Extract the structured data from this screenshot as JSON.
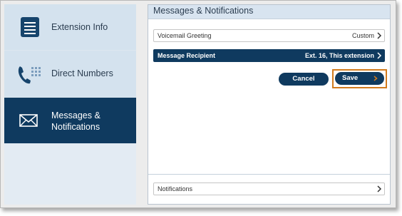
{
  "sidebar": {
    "items": [
      {
        "label": "Extension Info",
        "icon": "document-list-icon"
      },
      {
        "label": "Direct Numbers",
        "icon": "phone-keypad-icon"
      },
      {
        "label": "Messages &\nNotifications",
        "icon": "envelope-icon",
        "active": true
      }
    ]
  },
  "main": {
    "title": "Messages & Notifications",
    "voicemail": {
      "label": "Voicemail Greeting",
      "value": "Custom"
    },
    "recipient": {
      "label": "Message Recipient",
      "value": "Ext. 16, This extension"
    },
    "buttons": {
      "cancel": "Cancel",
      "save": "Save"
    },
    "notifications": {
      "label": "Notifications"
    }
  },
  "colors": {
    "navy": "#0f3a5f",
    "sidebar_bg": "#d4e2ee",
    "highlight": "#d27b1d"
  }
}
